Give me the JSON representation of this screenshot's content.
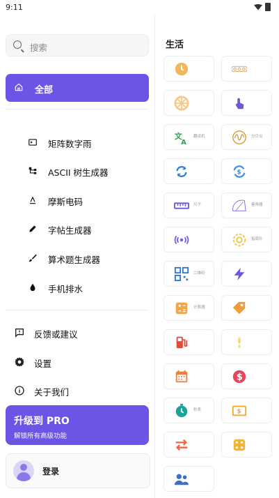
{
  "status_bar": {
    "time": "9:11"
  },
  "sidebar": {
    "search_placeholder": "搜索",
    "all_label": "全部",
    "items": [
      {
        "label": "矩阵数字雨",
        "icon": "terminal-icon"
      },
      {
        "label": "ASCII 树生成器",
        "icon": "tree-icon"
      },
      {
        "label": "摩斯电码",
        "icon": "morse-icon"
      },
      {
        "label": "字帖生成器",
        "icon": "pencil-icon"
      },
      {
        "label": "算术题生成器",
        "icon": "brush-icon"
      },
      {
        "label": "手机排水",
        "icon": "water-drop-icon"
      }
    ],
    "bottom_items": [
      {
        "label": "反馈或建议",
        "icon": "feedback-icon"
      },
      {
        "label": "设置",
        "icon": "gear-icon"
      },
      {
        "label": "关于我们",
        "icon": "info-icon"
      }
    ],
    "pro": {
      "title": "升级到 PRO",
      "subtitle": "解锁所有高级功能"
    },
    "login_label": "登录"
  },
  "main": {
    "section_title": "生活",
    "tiles": [
      {
        "label": "",
        "icon": "clock-icon",
        "color": "#f2b75b"
      },
      {
        "label": "",
        "icon": "indicator-dots-icon",
        "color": "#d6a55c"
      },
      {
        "label": "",
        "icon": "wheel-icon",
        "color": "#f6c98d"
      },
      {
        "label": "",
        "icon": "touch-icon",
        "color": "#6f57d6"
      },
      {
        "label": "翻译机",
        "icon": "translate-icon",
        "color": "#2f9f5a"
      },
      {
        "label": "分贝仪",
        "icon": "waveform-icon",
        "color": "#cf9a3a"
      },
      {
        "label": "",
        "icon": "sync-icon",
        "color": "#2a7dd8"
      },
      {
        "label": "",
        "icon": "currency-exchange-icon",
        "color": "#3c8fe6"
      },
      {
        "label": "尺子",
        "icon": "ruler-icon",
        "color": "#6a58db"
      },
      {
        "label": "量角器",
        "icon": "protractor-icon",
        "color": "#7e65e8"
      },
      {
        "label": "",
        "icon": "nfc-icon",
        "color": "#7560de"
      },
      {
        "label": "指南针",
        "icon": "compass-icon",
        "color": "#f2c14a"
      },
      {
        "label": "二维码",
        "icon": "qr-icon",
        "color": "#2a74d6"
      },
      {
        "label": "",
        "icon": "bolt-icon",
        "color": "#6a58db"
      },
      {
        "label": "计算器",
        "icon": "calculator-icon",
        "color": "#f4a64b"
      },
      {
        "label": "",
        "icon": "tag-icon",
        "color": "#f39c35"
      },
      {
        "label": "",
        "icon": "fuel-icon",
        "color": "#e3483c"
      },
      {
        "label": "",
        "icon": "bulb-icon",
        "color": "#f5d87a"
      },
      {
        "label": "",
        "icon": "calendar-icon",
        "color": "#f07f3e"
      },
      {
        "label": "",
        "icon": "dollar-icon",
        "color": "#e8455b"
      },
      {
        "label": "秒表",
        "icon": "stopwatch-icon",
        "color": "#1aa39b"
      },
      {
        "label": "",
        "icon": "money-bill-icon",
        "color": "#efac2c"
      },
      {
        "label": "",
        "icon": "swap-icon",
        "color": "#f2644a"
      },
      {
        "label": "",
        "icon": "dice-icon",
        "color": "#f0b436"
      },
      {
        "label": "",
        "icon": "group-icon",
        "color": "#3d6fc9"
      }
    ]
  }
}
